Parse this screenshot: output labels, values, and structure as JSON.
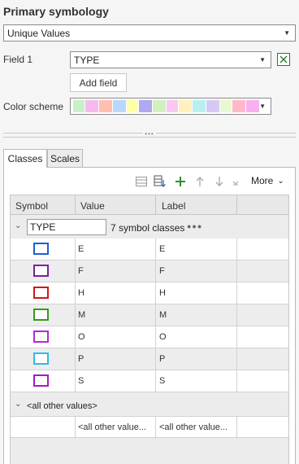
{
  "primary_heading": "Primary symbology",
  "symbology_select": {
    "value": "Unique Values"
  },
  "field1": {
    "label": "Field 1",
    "value": "TYPE"
  },
  "add_field_label": "Add field",
  "color_scheme": {
    "label": "Color scheme",
    "colors": [
      "#c8f0c8",
      "#f8b8f0",
      "#ffc0b0",
      "#b8d8ff",
      "#ffffa8",
      "#b0a8f0",
      "#d0f0c0",
      "#f8c8f0",
      "#fff0c0",
      "#b8f0f0",
      "#d8c8f8",
      "#e8f8d0",
      "#ffb8c8",
      "#f8b0f0"
    ]
  },
  "tabs": {
    "classes": "Classes",
    "scales": "Scales"
  },
  "toolbar": {
    "more_label": "More"
  },
  "table": {
    "headers": {
      "symbol": "Symbol",
      "value": "Value",
      "label": "Label"
    },
    "group_field": "TYPE",
    "group_count": "7 symbol classes",
    "group_more": "●●●",
    "rows": [
      {
        "value": "E",
        "label": "E",
        "color": "#1f5fd0"
      },
      {
        "value": "F",
        "label": "F",
        "color": "#7a1fa0"
      },
      {
        "value": "H",
        "label": "H",
        "color": "#d01818"
      },
      {
        "value": "M",
        "label": "M",
        "color": "#3a9a18"
      },
      {
        "value": "O",
        "label": "O",
        "color": "#b628d8"
      },
      {
        "value": "P",
        "label": "P",
        "color": "#30b8e8"
      },
      {
        "value": "S",
        "label": "S",
        "color": "#a818c8"
      }
    ],
    "other_group": "<all other values>",
    "other_row": {
      "value": "<all other value...",
      "label": "<all other value..."
    }
  }
}
